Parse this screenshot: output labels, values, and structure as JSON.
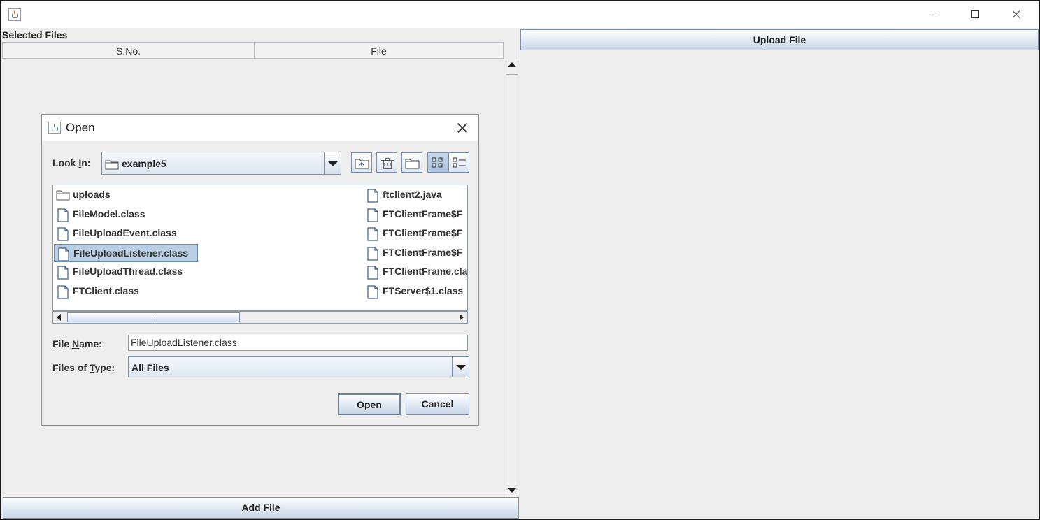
{
  "window": {
    "title": ""
  },
  "left_panel": {
    "heading": "Selected Files",
    "columns": [
      "S.No.",
      "File"
    ],
    "add_button": "Add File"
  },
  "right_panel": {
    "upload_button": "Upload File"
  },
  "dialog": {
    "title": "Open",
    "look_in": {
      "label_pre": "Look ",
      "label_key": "I",
      "label_post": "n:",
      "value": "example5"
    },
    "toolbar": [
      "up-one-level-icon",
      "home-icon",
      "new-folder-icon",
      "list-view-icon",
      "details-view-icon"
    ],
    "files_col1": [
      {
        "name": "uploads",
        "type": "folder"
      },
      {
        "name": "FileModel.class",
        "type": "file"
      },
      {
        "name": "FileUploadEvent.class",
        "type": "file"
      },
      {
        "name": "FileUploadListener.class",
        "type": "file",
        "selected": true
      },
      {
        "name": "FileUploadThread.class",
        "type": "file"
      },
      {
        "name": "FTClient.class",
        "type": "file"
      }
    ],
    "files_col2": [
      {
        "name": "ftclient2.java",
        "type": "file"
      },
      {
        "name": "FTClientFrame$F",
        "type": "file"
      },
      {
        "name": "FTClientFrame$F",
        "type": "file"
      },
      {
        "name": "FTClientFrame$F",
        "type": "file"
      },
      {
        "name": "FTClientFrame.cla",
        "type": "file"
      },
      {
        "name": "FTServer$1.class",
        "type": "file"
      }
    ],
    "file_name": {
      "label_pre": "File ",
      "label_key": "N",
      "label_post": "ame:",
      "value": "FileUploadListener.class"
    },
    "file_type": {
      "label_pre": "Files of ",
      "label_key": "T",
      "label_post": "ype:",
      "value": "All Files"
    },
    "open_button": "Open",
    "cancel_button": "Cancel"
  },
  "colors": {
    "selection": "#b8cfe5",
    "button_border": "#7a8ea8",
    "panel_bg": "#eeeeee"
  }
}
